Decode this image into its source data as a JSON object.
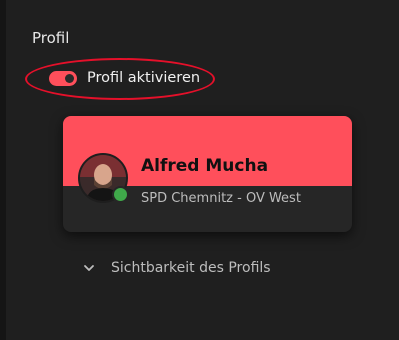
{
  "section": {
    "title": "Profil"
  },
  "toggle": {
    "label": "Profil aktivieren",
    "state": "on",
    "color": "#ff4f5b"
  },
  "card": {
    "name": "Alfred Mucha",
    "organization": "SPD Chemnitz - OV West",
    "header_color": "#ff4f5b",
    "status": "online",
    "status_color": "#3fa84a",
    "avatar_icon": "avatar-photo"
  },
  "visibility": {
    "label": "Sichtbarkeit des Profils",
    "icon": "chevron-down-icon"
  },
  "annotation": {
    "color": "#e5102a"
  }
}
